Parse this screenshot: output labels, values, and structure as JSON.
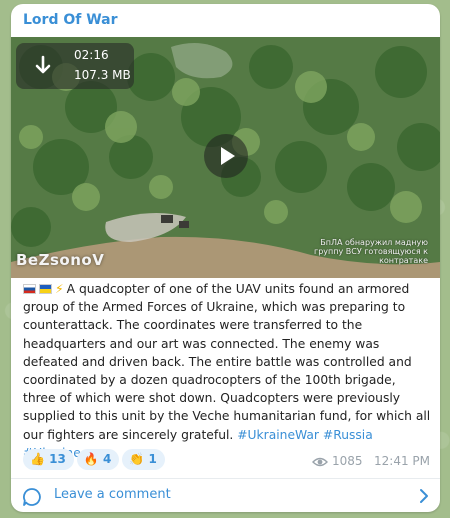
{
  "channel": {
    "title": "Lord Of War"
  },
  "media": {
    "duration": "02:16",
    "file_size": "107.3 MB",
    "watermark_left": "BeZsonoV",
    "watermark_right": "БпЛА обнаружил мадную группу ВСУ готовящуюся к контратаке",
    "download_icon": "download-arrow-icon",
    "play_icon": "play-icon"
  },
  "post": {
    "emoji_prefix": [
      "russia-flag",
      "ukraine-flag",
      "lightning-icon"
    ],
    "text": "A quadcopter of one of the UAV units found an armored group of the Armed Forces of Ukraine, which was preparing to counterattack.  The coordinates were transferred to the headquarters and our art was connected.  The enemy was defeated and driven back.  The entire battle was controlled and coordinated by a dozen quadrocopters of the 100th brigade, three of which were shot down.  Quadcopters were previously supplied to this unit by the Veche humanitarian fund, for which all our fighters are sincerely grateful. ",
    "hashtags": [
      "#UkraineWar",
      "#Russia",
      "#Ukraine"
    ]
  },
  "reactions": [
    {
      "emoji": "👍",
      "count": "13"
    },
    {
      "emoji": "🔥",
      "count": "4"
    },
    {
      "emoji": "👏",
      "count": "1"
    }
  ],
  "meta": {
    "views": "1085",
    "time": "12:41 PM"
  },
  "comments": {
    "label": "Leave a comment"
  },
  "colors": {
    "accent": "#3a8fd6",
    "meta": "#9aa3ab",
    "reaction_bg": "#e6f1fb"
  }
}
